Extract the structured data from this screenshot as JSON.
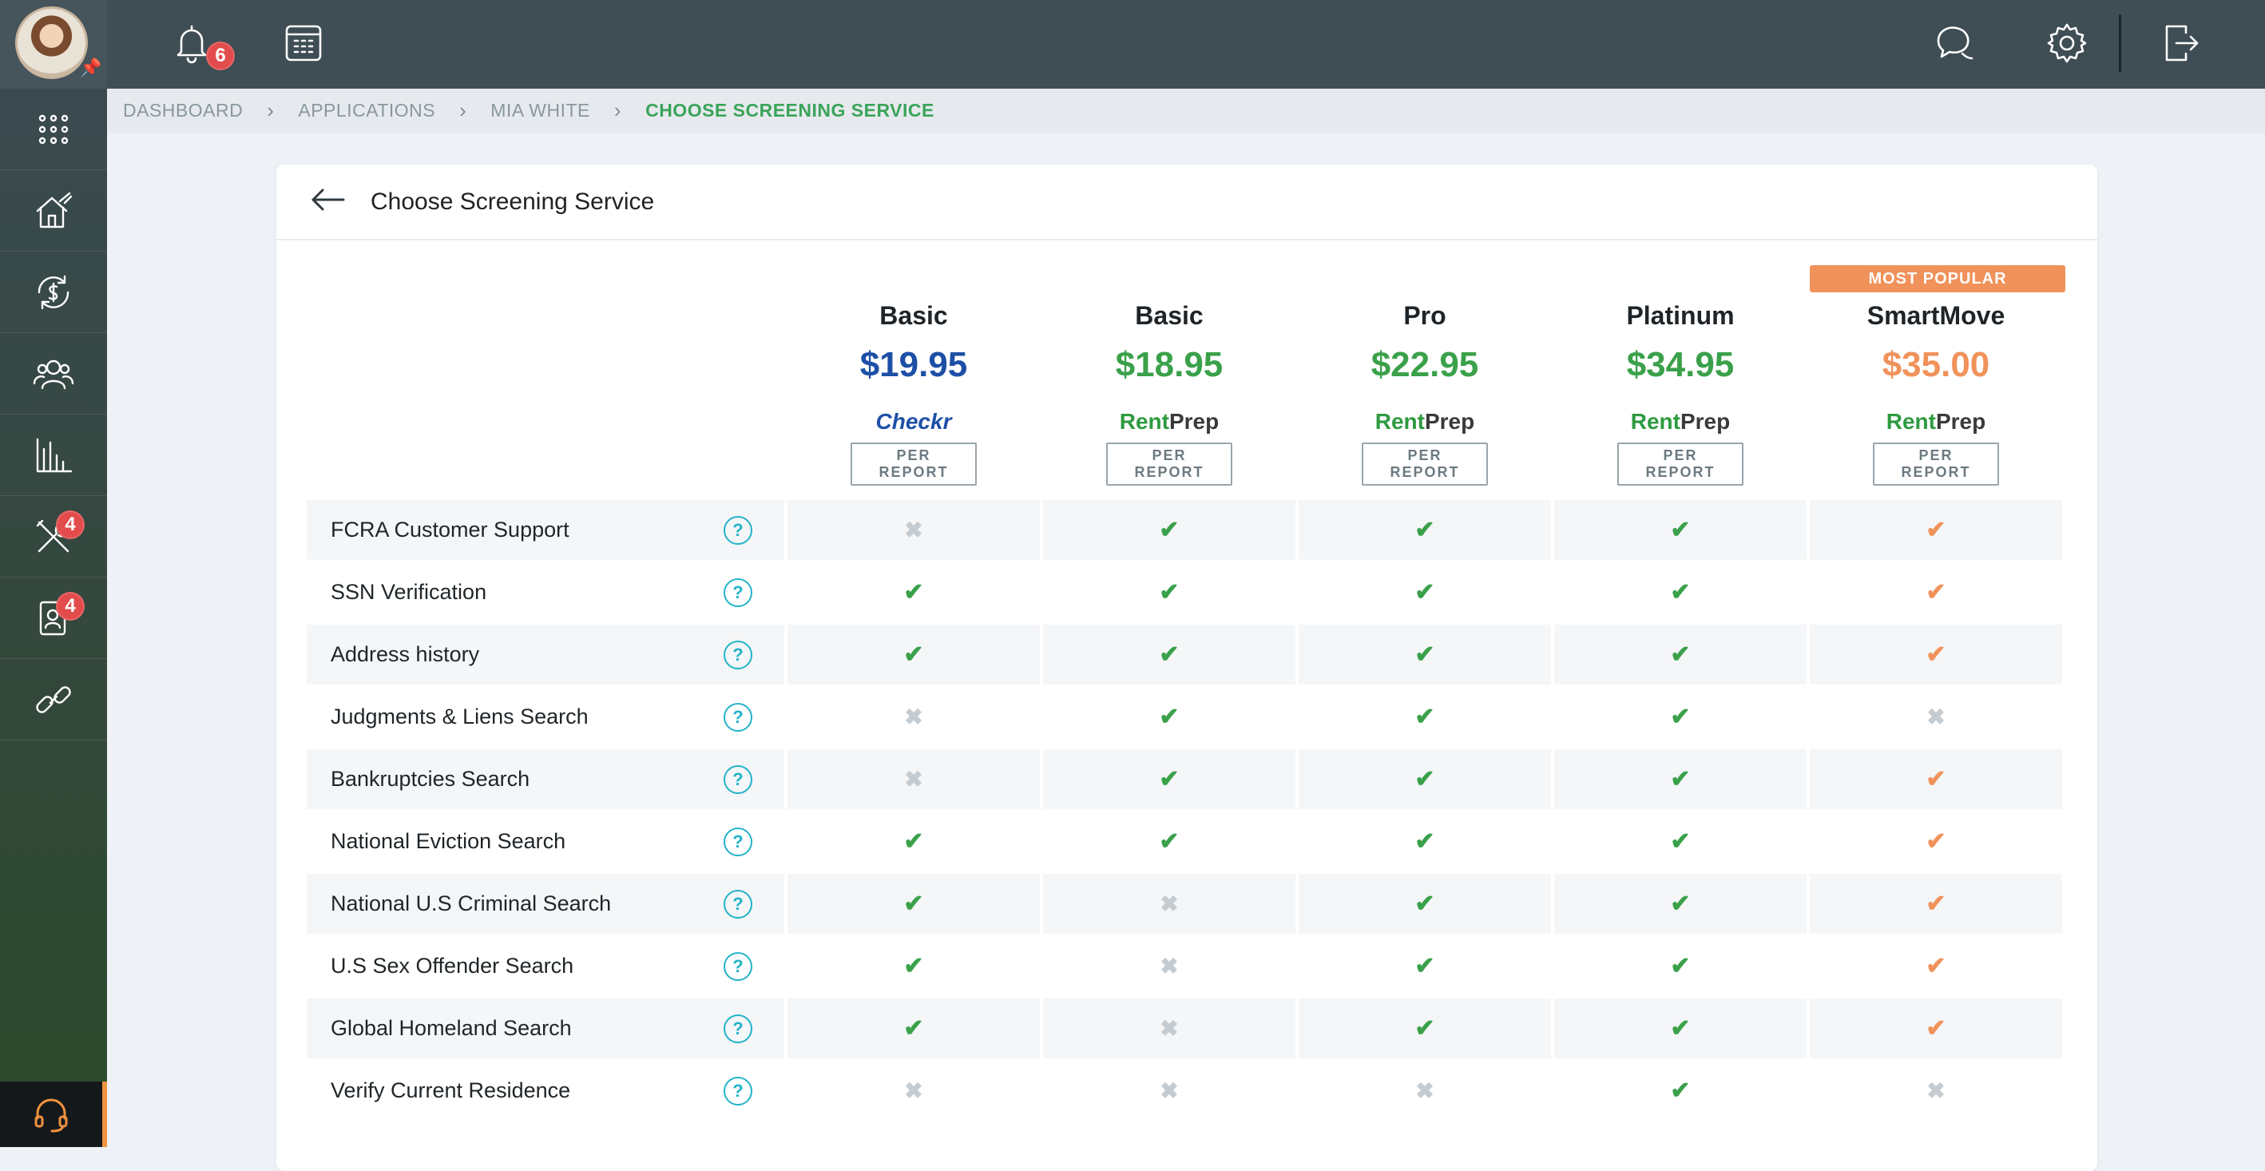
{
  "topbar": {
    "notifications_count": "6",
    "icons": [
      "bell-icon",
      "calendar-icon",
      "chat-icon",
      "gear-icon",
      "logout-icon"
    ]
  },
  "sidebar": {
    "items": [
      {
        "icon": "apps-grid-icon"
      },
      {
        "icon": "properties-icon"
      },
      {
        "icon": "payments-icon"
      },
      {
        "icon": "contacts-icon"
      },
      {
        "icon": "reports-icon"
      },
      {
        "icon": "maintenance-icon",
        "badge": "4"
      },
      {
        "icon": "applications-icon",
        "badge": "4"
      },
      {
        "icon": "integrations-icon"
      }
    ],
    "support_icon": "headset-icon"
  },
  "breadcrumb": {
    "items": [
      "DASHBOARD",
      "APPLICATIONS",
      "MIA WHITE"
    ],
    "current": "CHOOSE SCREENING SERVICE"
  },
  "page": {
    "title": "Choose Screening Service"
  },
  "colors": {
    "checkr_blue": "#1d4fa6",
    "rentprep_green": "#3aa14a",
    "smartmove_orange": "#f0925a",
    "help_cyan": "#23b3c8"
  },
  "plans": [
    {
      "name": "Basic",
      "price": "$19.95",
      "provider": "Checkr",
      "per_report": "PER REPORT",
      "color": "#1d4fa6"
    },
    {
      "name": "Basic",
      "price": "$18.95",
      "provider_a": "Rent",
      "provider_b": "Prep",
      "per_report": "PER REPORT",
      "color": "#3aa14a"
    },
    {
      "name": "Pro",
      "price": "$22.95",
      "provider_a": "Rent",
      "provider_b": "Prep",
      "per_report": "PER REPORT",
      "color": "#3aa14a"
    },
    {
      "name": "Platinum",
      "price": "$34.95",
      "provider_a": "Rent",
      "provider_b": "Prep",
      "per_report": "PER REPORT",
      "color": "#3aa14a"
    },
    {
      "name": "SmartMove",
      "price": "$35.00",
      "provider_a": "Rent",
      "provider_b": "Prep",
      "per_report": "PER REPORT",
      "color": "#f0925a",
      "tag": "MOST POPULAR"
    }
  ],
  "features": [
    {
      "label": "FCRA Customer Support",
      "values": [
        false,
        true,
        true,
        true,
        true
      ]
    },
    {
      "label": "SSN Verification",
      "values": [
        true,
        true,
        true,
        true,
        true
      ]
    },
    {
      "label": "Address history",
      "values": [
        true,
        true,
        true,
        true,
        true
      ]
    },
    {
      "label": "Judgments & Liens Search",
      "values": [
        false,
        true,
        true,
        true,
        false
      ]
    },
    {
      "label": "Bankruptcies Search",
      "values": [
        false,
        true,
        true,
        true,
        true
      ]
    },
    {
      "label": "National Eviction Search",
      "values": [
        true,
        true,
        true,
        true,
        true
      ]
    },
    {
      "label": "National U.S Criminal Search",
      "values": [
        true,
        false,
        true,
        true,
        true
      ]
    },
    {
      "label": "U.S Sex Offender Search",
      "values": [
        true,
        false,
        true,
        true,
        true
      ]
    },
    {
      "label": "Global Homeland Search",
      "values": [
        true,
        false,
        true,
        true,
        true
      ]
    },
    {
      "label": "Verify Current Residence",
      "values": [
        false,
        false,
        false,
        true,
        false
      ]
    }
  ],
  "symbols": {
    "check": "✔",
    "cross": "✖",
    "help": "?"
  }
}
